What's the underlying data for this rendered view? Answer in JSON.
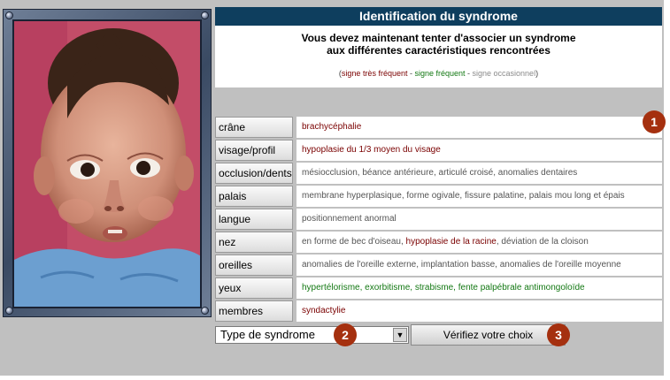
{
  "title": "Identification du syndrome",
  "intro": {
    "line1": "Vous devez maintenant tenter d'associer un syndrome",
    "line2": "aux différentes caractéristiques rencontrées"
  },
  "legend": {
    "open": "(",
    "very_frequent": "signe très fréquent",
    "sep1": " - ",
    "frequent": "signe fréquent",
    "sep2": " - ",
    "occasional": "signe occasionnel",
    "close": ")"
  },
  "colors": {
    "very_frequent": "#7a0000",
    "frequent": "#137813",
    "occasional": "#555555",
    "title_bar": "#0e3e5e",
    "badge": "#a5300f"
  },
  "rows": [
    {
      "label": "crâne",
      "values": [
        {
          "text": "brachycéphalie",
          "freq": "vf"
        }
      ]
    },
    {
      "label": "visage/profil",
      "values": [
        {
          "text": "hypoplasie du 1/3 moyen du visage",
          "freq": "vf"
        }
      ]
    },
    {
      "label": "occlusion/dents",
      "values": [
        {
          "text": "mésiocclusion, béance antérieure, articulé croisé, anomalies dentaires",
          "freq": "o"
        }
      ]
    },
    {
      "label": "palais",
      "values": [
        {
          "text": "membrane hyperplasique, forme ogivale, fissure palatine, palais mou long et épais",
          "freq": "o"
        }
      ]
    },
    {
      "label": "langue",
      "values": [
        {
          "text": "positionnement anormal",
          "freq": "o"
        }
      ]
    },
    {
      "label": "nez",
      "values": [
        {
          "text": "en forme de bec d'oiseau, ",
          "freq": "o"
        },
        {
          "text": "hypoplasie de la racine",
          "freq": "vf"
        },
        {
          "text": ", déviation de la cloison",
          "freq": "o"
        }
      ]
    },
    {
      "label": "oreilles",
      "values": [
        {
          "text": "anomalies de l'oreille externe, implantation basse, anomalies de l'oreille moyenne",
          "freq": "o"
        }
      ]
    },
    {
      "label": "yeux",
      "values": [
        {
          "text": "hypertélorisme, exorbitisme, strabisme, fente palpébrale antimongoloïde",
          "freq": "f"
        }
      ]
    },
    {
      "label": "membres",
      "values": [
        {
          "text": "syndactylie",
          "freq": "vf"
        }
      ]
    }
  ],
  "select": {
    "value": "Type de syndrome",
    "arrow_icon": "triangle-down-icon"
  },
  "verify_button": "Vérifiez votre choix",
  "badges": [
    "1",
    "2",
    "3"
  ]
}
